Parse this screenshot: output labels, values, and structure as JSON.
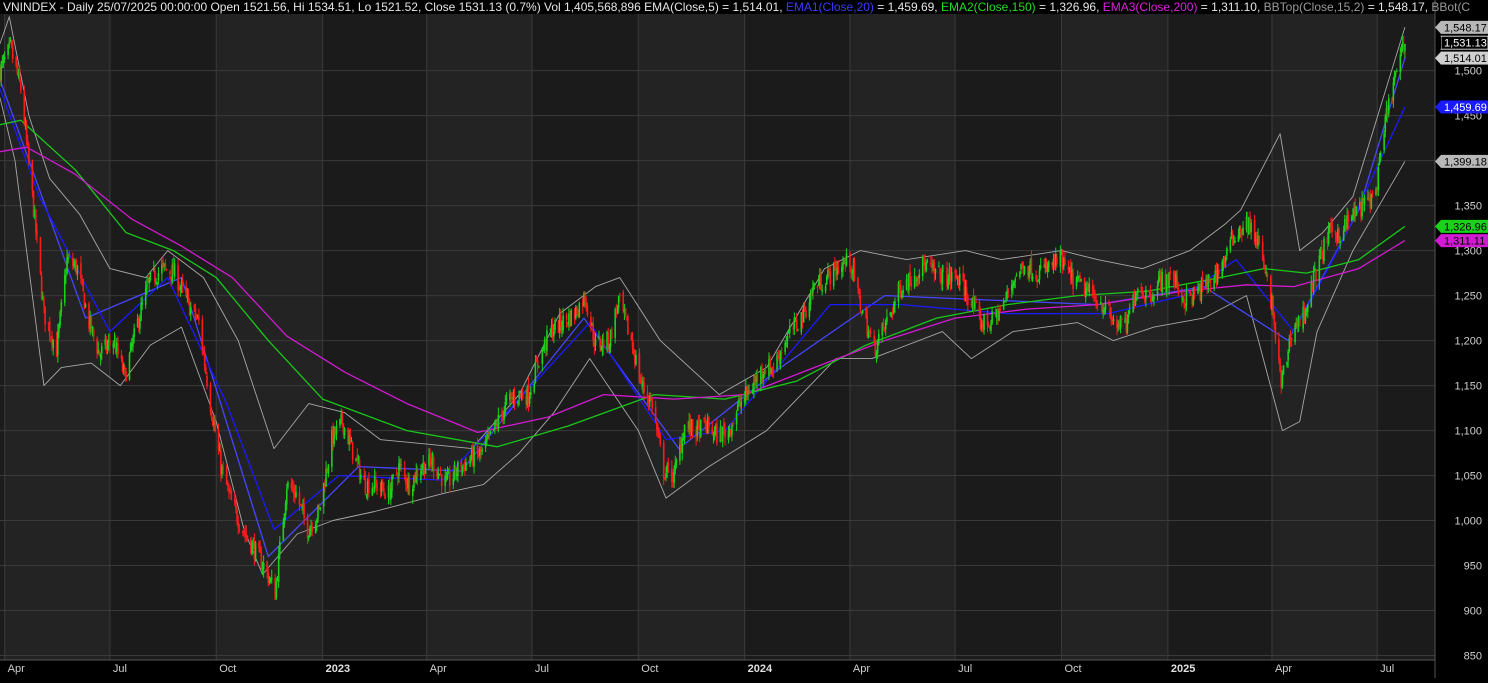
{
  "colors": {
    "background": "#000000",
    "plot_band_dark": "#1b1b1b",
    "plot_band_light": "#232323",
    "grid": "#3a3a3a",
    "axis_text": "#cfcfcf",
    "candle_up": "#19d219",
    "candle_down": "#ff1a1a",
    "ema5": "#4646ff",
    "ema20": "#1a1aff",
    "ema150": "#19c819",
    "ema200": "#d21ad2",
    "bollinger": "#a8a8a8"
  },
  "header": {
    "segments": [
      {
        "text": "VNINDEX - Daily 25/07/2025 00:00:00 Open 1521.56, Hi 1534.51, Lo 1521.52, Close 1531.13 (0.7%) Vol 1,405,568,896 ",
        "color": "#e6e6e6"
      },
      {
        "text": "EMA(Close,5)",
        "color": "#e6e6e6"
      },
      {
        "text": " = 1,514.01, ",
        "color": "#e6e6e6"
      },
      {
        "text": "EMA1(Close,20)",
        "color": "#3c3cff"
      },
      {
        "text": " = 1,459.69, ",
        "color": "#e6e6e6"
      },
      {
        "text": "EMA2(Close,150)",
        "color": "#22dd22"
      },
      {
        "text": " = 1,326.96, ",
        "color": "#e6e6e6"
      },
      {
        "text": "EMA3(Close,200)",
        "color": "#dd22dd"
      },
      {
        "text": " = 1,311.10, ",
        "color": "#e6e6e6"
      },
      {
        "text": "BBTop(Close,15,2)",
        "color": "#9a9a9a"
      },
      {
        "text": " = 1,548.17, ",
        "color": "#e6e6e6"
      },
      {
        "text": "BBot(C",
        "color": "#9a9a9a"
      }
    ]
  },
  "chart_data": {
    "type": "candlestick",
    "symbol": "VNINDEX",
    "interval": "Daily",
    "last_bar": {
      "date": "25/07/2025 00:00:00",
      "open": 1521.56,
      "high": 1534.51,
      "low": 1521.52,
      "close": 1531.13,
      "change_pct": 0.7,
      "volume": 1405568896
    },
    "x_range": [
      "2022-03-28",
      "2025-08-20"
    ],
    "ylim": [
      845,
      1563
    ],
    "y_ticks": [
      850,
      900,
      950,
      1000,
      1050,
      1100,
      1150,
      1200,
      1250,
      1300,
      1350,
      1400,
      1450,
      1500
    ],
    "y_tick_labels": [
      "850",
      "900",
      "950",
      "1,000",
      "1,050",
      "1,100",
      "1,150",
      "1,200",
      "1,250",
      "1,300",
      "1,350",
      "1,400",
      "1,450",
      "1,500"
    ],
    "x_ticks": [
      {
        "date": "2022-04-01",
        "label": "Apr",
        "bold": false
      },
      {
        "date": "2022-07-01",
        "label": "Jul",
        "bold": false
      },
      {
        "date": "2022-10-01",
        "label": "Oct",
        "bold": false
      },
      {
        "date": "2023-01-01",
        "label": "2023",
        "bold": true
      },
      {
        "date": "2023-04-01",
        "label": "Apr",
        "bold": false
      },
      {
        "date": "2023-07-01",
        "label": "Jul",
        "bold": false
      },
      {
        "date": "2023-10-01",
        "label": "Oct",
        "bold": false
      },
      {
        "date": "2024-01-01",
        "label": "2024",
        "bold": true
      },
      {
        "date": "2024-04-01",
        "label": "Apr",
        "bold": false
      },
      {
        "date": "2024-07-01",
        "label": "Jul",
        "bold": false
      },
      {
        "date": "2024-10-01",
        "label": "Oct",
        "bold": false
      },
      {
        "date": "2025-01-01",
        "label": "2025",
        "bold": true
      },
      {
        "date": "2025-04-01",
        "label": "Apr",
        "bold": false
      },
      {
        "date": "2025-07-01",
        "label": "Jul",
        "bold": false
      }
    ],
    "close_series": {
      "x": [
        "2022-03-28",
        "2022-04-06",
        "2022-04-15",
        "2022-04-25",
        "2022-05-05",
        "2022-05-16",
        "2022-05-25",
        "2022-06-03",
        "2022-06-13",
        "2022-06-22",
        "2022-07-04",
        "2022-07-14",
        "2022-07-25",
        "2022-08-04",
        "2022-08-15",
        "2022-08-26",
        "2022-09-07",
        "2022-09-16",
        "2022-09-26",
        "2022-10-05",
        "2022-10-14",
        "2022-10-24",
        "2022-11-02",
        "2022-11-11",
        "2022-11-21",
        "2022-12-01",
        "2022-12-09",
        "2022-12-19",
        "2022-12-29",
        "2023-01-09",
        "2023-01-18",
        "2023-02-06",
        "2023-02-15",
        "2023-02-27",
        "2023-03-08",
        "2023-03-17",
        "2023-03-27",
        "2023-04-06",
        "2023-04-18",
        "2023-04-27",
        "2023-05-10",
        "2023-05-19",
        "2023-05-31",
        "2023-06-09",
        "2023-06-19",
        "2023-06-28",
        "2023-07-07",
        "2023-07-17",
        "2023-07-27",
        "2023-08-07",
        "2023-08-16",
        "2023-08-25",
        "2023-09-06",
        "2023-09-14",
        "2023-09-25",
        "2023-10-04",
        "2023-10-13",
        "2023-10-23",
        "2023-11-01",
        "2023-11-10",
        "2023-11-20",
        "2023-11-29",
        "2023-12-08",
        "2023-12-18",
        "2023-12-28",
        "2024-01-08",
        "2024-01-17",
        "2024-01-26",
        "2024-02-05",
        "2024-02-21",
        "2024-03-01",
        "2024-03-12",
        "2024-03-21",
        "2024-04-01",
        "2024-04-10",
        "2024-04-22",
        "2024-05-06",
        "2024-05-15",
        "2024-05-24",
        "2024-06-04",
        "2024-06-13",
        "2024-06-24",
        "2024-07-03",
        "2024-07-12",
        "2024-07-23",
        "2024-08-01",
        "2024-08-12",
        "2024-08-21",
        "2024-08-30",
        "2024-09-10",
        "2024-09-19",
        "2024-09-30",
        "2024-10-09",
        "2024-10-18",
        "2024-10-28",
        "2024-11-06",
        "2024-11-15",
        "2024-11-26",
        "2024-12-05",
        "2024-12-16",
        "2024-12-25",
        "2025-01-06",
        "2025-01-15",
        "2025-01-24",
        "2025-02-10",
        "2025-02-19",
        "2025-02-28",
        "2025-03-11",
        "2025-03-20",
        "2025-04-01",
        "2025-04-09",
        "2025-04-18",
        "2025-04-29",
        "2025-05-12",
        "2025-05-21",
        "2025-05-30",
        "2025-06-10",
        "2025-06-19",
        "2025-06-30",
        "2025-07-09",
        "2025-07-18",
        "2025-07-25"
      ],
      "y": [
        1500,
        1525,
        1480,
        1360,
        1230,
        1190,
        1290,
        1280,
        1220,
        1185,
        1200,
        1160,
        1220,
        1265,
        1280,
        1275,
        1240,
        1220,
        1130,
        1060,
        1020,
        990,
        970,
        950,
        920,
        1040,
        1030,
        990,
        1010,
        1090,
        1110,
        1040,
        1040,
        1030,
        1060,
        1040,
        1060,
        1065,
        1040,
        1055,
        1070,
        1075,
        1105,
        1130,
        1140,
        1140,
        1180,
        1210,
        1220,
        1230,
        1250,
        1195,
        1200,
        1245,
        1200,
        1150,
        1130,
        1055,
        1050,
        1105,
        1100,
        1105,
        1095,
        1100,
        1130,
        1150,
        1170,
        1170,
        1200,
        1230,
        1260,
        1270,
        1280,
        1290,
        1240,
        1190,
        1230,
        1260,
        1270,
        1285,
        1275,
        1270,
        1270,
        1250,
        1220,
        1220,
        1240,
        1270,
        1285,
        1275,
        1280,
        1290,
        1270,
        1260,
        1250,
        1240,
        1220,
        1215,
        1260,
        1250,
        1265,
        1270,
        1245,
        1250,
        1270,
        1290,
        1320,
        1330,
        1310,
        1240,
        1150,
        1210,
        1230,
        1290,
        1320,
        1320,
        1340,
        1350,
        1365,
        1450,
        1500,
        1531.13
      ]
    },
    "series": [
      {
        "name": "EMA(Close,5)",
        "last_value": 1514.01,
        "label": "1,514.01",
        "color": "#4646ff",
        "x": [
          "2022-03-28",
          "2022-06-10",
          "2022-09-01",
          "2022-11-15",
          "2023-02-01",
          "2023-05-01",
          "2023-08-15",
          "2023-11-05",
          "2024-02-01",
          "2024-05-01",
          "2024-08-01",
          "2024-11-01",
          "2025-02-01",
          "2025-04-15",
          "2025-06-15",
          "2025-07-25"
        ],
        "y": [
          1490,
          1225,
          1270,
          960,
          1060,
          1055,
          1225,
          1080,
          1170,
          1250,
          1245,
          1240,
          1260,
          1200,
          1345,
          1514.01
        ]
      },
      {
        "name": "EMA1(Close,20)",
        "last_value": 1459.69,
        "label": "1,459.69",
        "color": "#1a1aff",
        "x": [
          "2022-03-28",
          "2022-05-01",
          "2022-07-01",
          "2022-08-20",
          "2022-10-10",
          "2022-11-20",
          "2023-01-15",
          "2023-04-15",
          "2023-07-01",
          "2023-08-20",
          "2023-10-25",
          "2023-12-15",
          "2024-03-15",
          "2024-05-15",
          "2024-08-15",
          "2024-11-10",
          "2025-01-15",
          "2025-03-01",
          "2025-04-20",
          "2025-06-01",
          "2025-07-25"
        ],
        "y": [
          1480,
          1360,
          1210,
          1270,
          1130,
          990,
          1050,
          1045,
          1150,
          1220,
          1090,
          1100,
          1240,
          1240,
          1230,
          1230,
          1250,
          1290,
          1210,
          1310,
          1459.69
        ]
      },
      {
        "name": "EMA2(Close,150)",
        "last_value": 1326.96,
        "label": "1,326.96",
        "color": "#19c819",
        "x": [
          "2022-03-28",
          "2022-04-15",
          "2022-06-01",
          "2022-07-15",
          "2022-08-25",
          "2022-10-01",
          "2022-11-15",
          "2023-01-01",
          "2023-03-15",
          "2023-06-01",
          "2023-08-01",
          "2023-10-15",
          "2023-12-15",
          "2024-02-15",
          "2024-04-15",
          "2024-06-15",
          "2024-08-15",
          "2024-10-15",
          "2024-12-15",
          "2025-02-15",
          "2025-03-25",
          "2025-05-01",
          "2025-06-15",
          "2025-07-25"
        ],
        "y": [
          1440,
          1445,
          1390,
          1320,
          1300,
          1270,
          1200,
          1135,
          1100,
          1082,
          1105,
          1140,
          1135,
          1155,
          1195,
          1225,
          1240,
          1250,
          1255,
          1270,
          1280,
          1275,
          1290,
          1326.96
        ]
      },
      {
        "name": "EMA3(Close,200)",
        "last_value": 1311.1,
        "label": "1,311.11",
        "color": "#d21ad2",
        "x": [
          "2022-03-28",
          "2022-04-20",
          "2022-06-01",
          "2022-07-20",
          "2022-09-01",
          "2022-10-15",
          "2022-12-01",
          "2023-01-20",
          "2023-03-15",
          "2023-05-15",
          "2023-07-15",
          "2023-09-01",
          "2023-11-01",
          "2024-01-01",
          "2024-03-01",
          "2024-05-01",
          "2024-07-01",
          "2024-09-01",
          "2024-11-01",
          "2025-01-15",
          "2025-03-10",
          "2025-04-20",
          "2025-06-15",
          "2025-07-25"
        ],
        "y": [
          1410,
          1415,
          1385,
          1335,
          1305,
          1270,
          1205,
          1165,
          1130,
          1098,
          1115,
          1140,
          1135,
          1140,
          1170,
          1200,
          1225,
          1235,
          1240,
          1255,
          1262,
          1260,
          1280,
          1311.1
        ]
      },
      {
        "name": "BBTop(Close,15,2)",
        "last_value": 1548.17,
        "label": "1,548.17",
        "color": "#a8a8a8",
        "x": [
          "2022-03-28",
          "2022-04-05",
          "2022-04-22",
          "2022-05-10",
          "2022-06-05",
          "2022-07-01",
          "2022-08-01",
          "2022-08-20",
          "2022-09-20",
          "2022-10-20",
          "2022-11-20",
          "2022-12-20",
          "2023-01-20",
          "2023-02-20",
          "2023-04-01",
          "2023-05-10",
          "2023-06-20",
          "2023-07-25",
          "2023-08-25",
          "2023-09-15",
          "2023-10-20",
          "2023-12-10",
          "2024-01-20",
          "2024-03-10",
          "2024-04-10",
          "2024-05-20",
          "2024-07-10",
          "2024-08-10",
          "2024-10-01",
          "2024-11-01",
          "2024-12-10",
          "2025-01-20",
          "2025-02-20",
          "2025-03-05",
          "2025-04-08",
          "2025-04-25",
          "2025-05-15",
          "2025-06-10",
          "2025-07-25"
        ],
        "y": [
          1530,
          1560,
          1450,
          1380,
          1340,
          1280,
          1270,
          1300,
          1270,
          1200,
          1080,
          1130,
          1120,
          1090,
          1085,
          1080,
          1140,
          1230,
          1260,
          1270,
          1200,
          1140,
          1170,
          1280,
          1300,
          1290,
          1300,
          1290,
          1300,
          1290,
          1280,
          1300,
          1330,
          1345,
          1430,
          1300,
          1320,
          1360,
          1548.17
        ]
      },
      {
        "name": "BBot(Close,15,2)",
        "label": "1,399.18",
        "color": "#a8a8a8",
        "x": [
          "2022-03-28",
          "2022-04-10",
          "2022-05-05",
          "2022-05-20",
          "2022-06-15",
          "2022-07-10",
          "2022-08-05",
          "2022-09-01",
          "2022-10-01",
          "2022-10-25",
          "2022-11-10",
          "2022-12-10",
          "2023-01-10",
          "2023-02-15",
          "2023-04-15",
          "2023-05-20",
          "2023-06-20",
          "2023-07-20",
          "2023-08-20",
          "2023-10-01",
          "2023-10-25",
          "2023-12-01",
          "2024-01-20",
          "2024-03-20",
          "2024-04-20",
          "2024-06-20",
          "2024-07-15",
          "2024-08-20",
          "2024-10-15",
          "2024-11-15",
          "2024-12-20",
          "2025-02-01",
          "2025-03-10",
          "2025-04-10",
          "2025-04-25",
          "2025-05-10",
          "2025-06-10",
          "2025-07-25"
        ],
        "y": [
          1470,
          1400,
          1150,
          1170,
          1175,
          1150,
          1195,
          1215,
          1110,
          990,
          940,
          985,
          1000,
          1010,
          1030,
          1040,
          1075,
          1120,
          1180,
          1100,
          1025,
          1060,
          1100,
          1180,
          1180,
          1210,
          1180,
          1210,
          1220,
          1200,
          1215,
          1225,
          1250,
          1100,
          1110,
          1210,
          1300,
          1399.18
        ]
      }
    ],
    "price_labels": [
      {
        "value": 1548.17,
        "label": "1,548.17",
        "bg": "#b8b8b8",
        "fg": "#000000"
      },
      {
        "value": 1531.13,
        "label": "1,531.13",
        "bg": "#000000",
        "fg": "#ffffff",
        "border": "#ffffff"
      },
      {
        "value": 1514.01,
        "label": "1,514.01",
        "bg": "#d0d0d0",
        "fg": "#000000"
      },
      {
        "value": 1459.69,
        "label": "1,459.69",
        "bg": "#1a1aff",
        "fg": "#ffffff"
      },
      {
        "value": 1399.18,
        "label": "1,399.18",
        "bg": "#b8b8b8",
        "fg": "#000000"
      },
      {
        "value": 1326.96,
        "label": "1,326.96",
        "bg": "#19d219",
        "fg": "#000000"
      },
      {
        "value": 1311.1,
        "label": "1,311.11",
        "bg": "#d21ad2",
        "fg": "#000000"
      }
    ]
  }
}
